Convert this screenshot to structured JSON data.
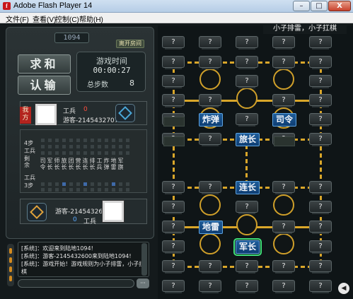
{
  "window": {
    "title": "Adobe Flash Player 14",
    "icon_letter": "f",
    "min": "–",
    "max": "□",
    "close": "X"
  },
  "menu": [
    "文件(F)",
    "查看(V)",
    "控制(C)",
    "帮助(H)"
  ],
  "game": {
    "room_no": "1094",
    "start_tag": "离开房间",
    "mode_header": "小子排雷，小子扛棋",
    "btn_draw": "求和",
    "btn_surrender": "认输",
    "time_label": "游戏时间",
    "time_value": "00:00:27",
    "steps_label": "总步数",
    "steps_value": "8",
    "me": {
      "tag": "我方",
      "rank": "工兵",
      "score": "0",
      "name": "游客-2145432707"
    },
    "opponent": {
      "name": "游客-2145432600",
      "score": "0",
      "rank": "工兵"
    },
    "stats_labels": {
      "top_steps": "4步",
      "top_rank": "工兵",
      "remain": "剩余",
      "bottom_rank": "工兵",
      "bottom_steps": "3步"
    },
    "rank_columns": [
      "司令",
      "军长",
      "师长",
      "旅长",
      "团长",
      "营长",
      "连长",
      "排长",
      "工兵",
      "炸弹",
      "地雷",
      "军旗"
    ],
    "chat": [
      "[系统]：欢迎来到陆地1094!",
      "[系统]：游客-2145432600来到陆地1094!",
      "[系统]：游戏开始！游戏规则为小子排雷，小子扛",
      "棋"
    ],
    "send": "···",
    "sound": "◀"
  },
  "board": {
    "hidden": "?",
    "pieces": [
      "炸弹",
      "司令",
      "旅长",
      "连长",
      "地雷",
      "军长"
    ]
  },
  "colors": {
    "rail": "#d9a62a",
    "piece_blue": "#1f5d9a",
    "me_red": "#b3231e",
    "select": "#3fe07a"
  }
}
